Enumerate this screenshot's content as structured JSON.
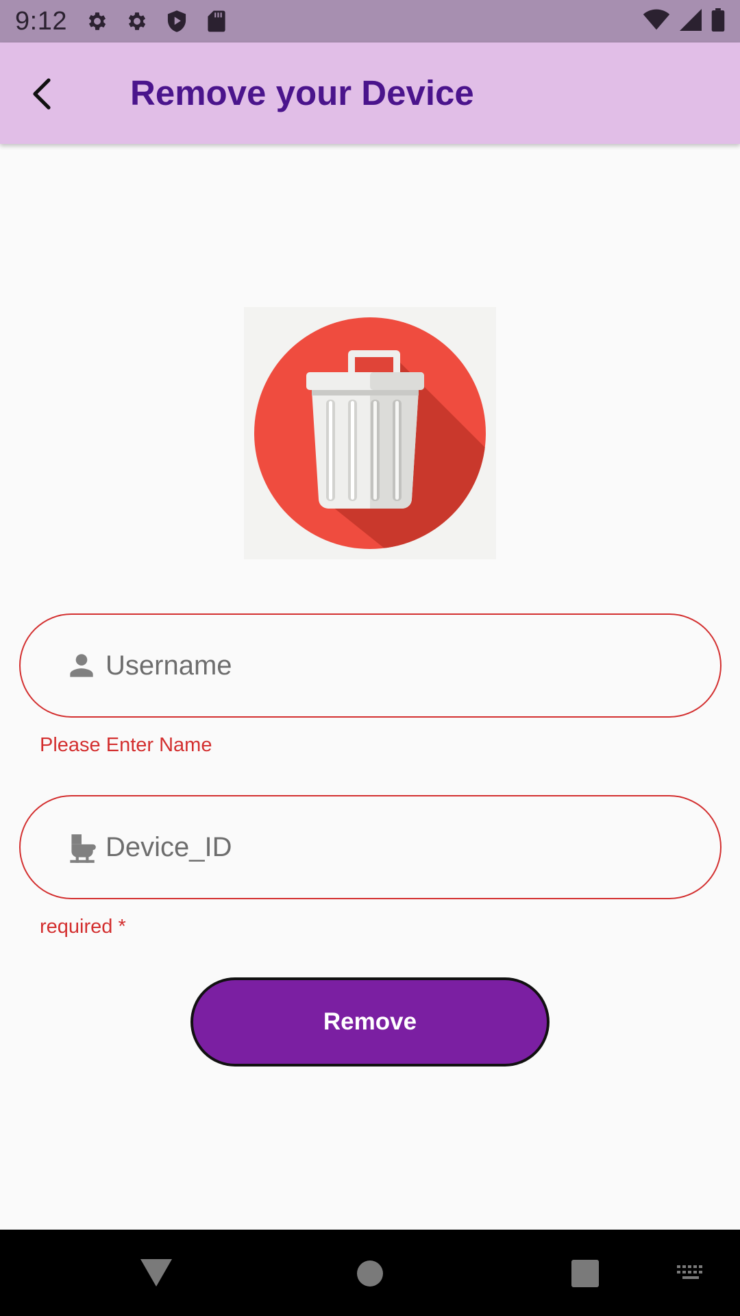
{
  "status_bar": {
    "time": "9:12",
    "icons_left": [
      "gear-icon",
      "gear-icon",
      "shield-play-icon",
      "sd-card-icon"
    ],
    "icons_right": [
      "wifi-icon",
      "signal-icon",
      "battery-icon"
    ]
  },
  "app_bar": {
    "title": "Remove your Device",
    "back_icon": "chevron-left-icon"
  },
  "hero": {
    "icon": "trash-can-icon"
  },
  "form": {
    "username": {
      "placeholder": "Username",
      "value": "",
      "icon": "person-icon",
      "error": "Please Enter Name"
    },
    "device_id": {
      "placeholder": "Device_ID",
      "value": "",
      "icon": "device-icon",
      "error": "required *"
    },
    "submit_label": "Remove"
  },
  "nav_bar": {
    "icons": [
      "back-triangle-icon",
      "home-circle-icon",
      "recents-square-icon",
      "keyboard-icon"
    ]
  },
  "colors": {
    "status_bar": "#a78fb0",
    "app_bar": "#e1bee7",
    "title": "#4a148c",
    "error": "#d32f2f",
    "button": "#7b1fa2",
    "trash_circle": "#ef4c3f"
  }
}
